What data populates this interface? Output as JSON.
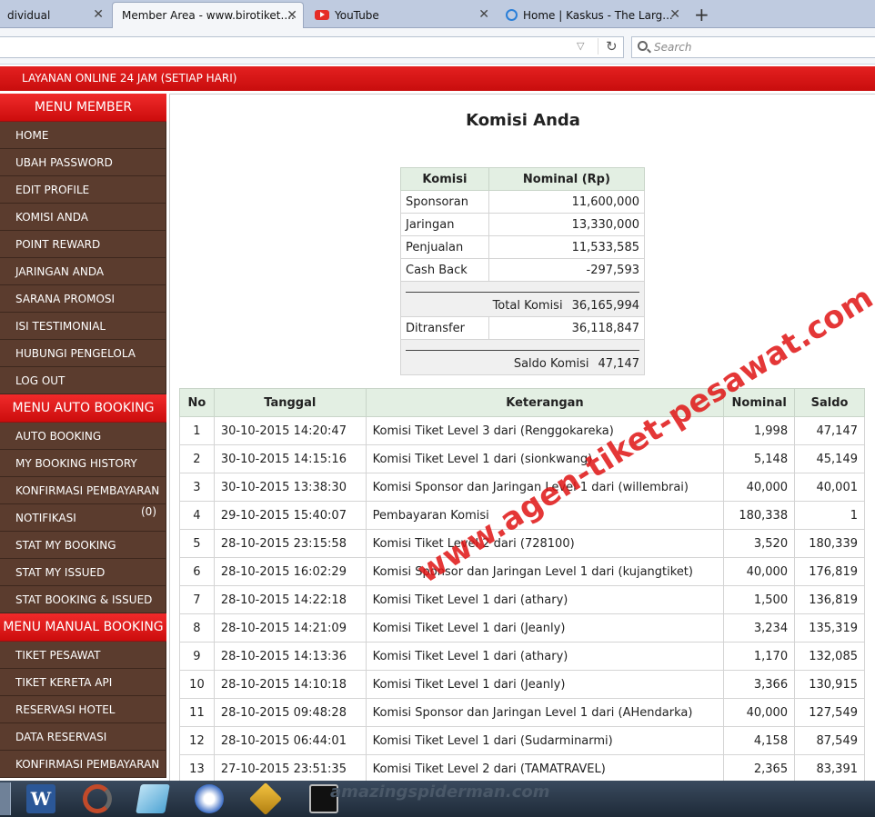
{
  "browser": {
    "tabs": [
      {
        "label": "dividual"
      },
      {
        "label": "Member Area - www.birotiket...."
      },
      {
        "label": "YouTube"
      },
      {
        "label": "Home | Kaskus - The Larg..."
      }
    ],
    "close_glyph": "✕",
    "new_tab_glyph": "+",
    "search_placeholder": "Search",
    "dropdown_glyph": "▽",
    "reload_glyph": "↻"
  },
  "banner": {
    "text": "LAYANAN ONLINE 24 JAM (SETIAP HARI)"
  },
  "sidebar": {
    "sections": [
      {
        "header": "MENU MEMBER",
        "items": [
          "HOME",
          "UBAH PASSWORD",
          "EDIT PROFILE",
          "KOMISI ANDA",
          "POINT REWARD",
          "JARINGAN ANDA",
          "SARANA PROMOSI",
          "ISI TESTIMONIAL",
          "HUBUNGI PENGELOLA",
          "LOG OUT"
        ]
      },
      {
        "header": "MENU AUTO BOOKING",
        "items": [
          "AUTO BOOKING",
          "MY BOOKING HISTORY",
          "KONFIRMASI PEMBAYARAN",
          "NOTIFIKASI",
          "STAT MY BOOKING",
          "STAT MY ISSUED",
          "STAT BOOKING & ISSUED"
        ],
        "notification_badge": "(0)"
      },
      {
        "header": "MENU MANUAL BOOKING",
        "items": [
          "TIKET PESAWAT",
          "TIKET KERETA API",
          "RESERVASI HOTEL",
          "DATA RESERVASI",
          "KONFIRMASI PEMBAYARAN"
        ]
      }
    ]
  },
  "main": {
    "title": "Komisi Anda",
    "summary": {
      "headers": [
        "Komisi",
        "Nominal (Rp)"
      ],
      "rows": [
        {
          "label": "Sponsoran",
          "value": "11,600,000"
        },
        {
          "label": "Jaringan",
          "value": "13,330,000"
        },
        {
          "label": "Penjualan",
          "value": "11,533,585"
        },
        {
          "label": "Cash Back",
          "value": "-297,593"
        }
      ],
      "total_label": "Total Komisi",
      "total_value": "36,165,994",
      "transfer_label": "Ditransfer",
      "transfer_value": "36,118,847",
      "saldo_label": "Saldo Komisi",
      "saldo_value": "47,147"
    },
    "history": {
      "headers": [
        "No",
        "Tanggal",
        "Keterangan",
        "Nominal",
        "Saldo"
      ],
      "rows": [
        [
          "1",
          "30-10-2015 14:20:47",
          "Komisi Tiket Level 3 dari (Renggokareka)",
          "1,998",
          "47,147"
        ],
        [
          "2",
          "30-10-2015 14:15:16",
          "Komisi Tiket Level 1 dari (sionkwang)",
          "5,148",
          "45,149"
        ],
        [
          "3",
          "30-10-2015 13:38:30",
          "Komisi Sponsor dan Jaringan Level 1 dari (willembrai)",
          "40,000",
          "40,001"
        ],
        [
          "4",
          "29-10-2015 15:40:07",
          "Pembayaran Komisi",
          "180,338",
          "1"
        ],
        [
          "5",
          "28-10-2015 23:15:58",
          "Komisi Tiket Level 2 dari (728100)",
          "3,520",
          "180,339"
        ],
        [
          "6",
          "28-10-2015 16:02:29",
          "Komisi Sponsor dan Jaringan Level 1 dari (kujangtiket)",
          "40,000",
          "176,819"
        ],
        [
          "7",
          "28-10-2015 14:22:18",
          "Komisi Tiket Level 1 dari (athary)",
          "1,500",
          "136,819"
        ],
        [
          "8",
          "28-10-2015 14:21:09",
          "Komisi Tiket Level 1 dari (Jeanly)",
          "3,234",
          "135,319"
        ],
        [
          "9",
          "28-10-2015 14:13:36",
          "Komisi Tiket Level 1 dari (athary)",
          "1,170",
          "132,085"
        ],
        [
          "10",
          "28-10-2015 14:10:18",
          "Komisi Tiket Level 1 dari (Jeanly)",
          "3,366",
          "130,915"
        ],
        [
          "11",
          "28-10-2015 09:48:28",
          "Komisi Sponsor dan Jaringan Level 1 dari (AHendarka)",
          "40,000",
          "127,549"
        ],
        [
          "12",
          "28-10-2015 06:44:01",
          "Komisi Tiket Level 1 dari (Sudarminarmi)",
          "4,158",
          "87,549"
        ],
        [
          "13",
          "27-10-2015 23:51:35",
          "Komisi Tiket Level 2 dari (TAMATRAVEL)",
          "2,365",
          "83,391"
        ]
      ]
    },
    "watermark": "www.agen-tiket-pesawat.com"
  },
  "taskbar": {
    "word_glyph": "W",
    "text": "amazingspiderman.com"
  },
  "colors": {
    "accent_red": "#d41414",
    "menu_brown": "#5b3c2e",
    "table_header": "#e3efe3"
  }
}
